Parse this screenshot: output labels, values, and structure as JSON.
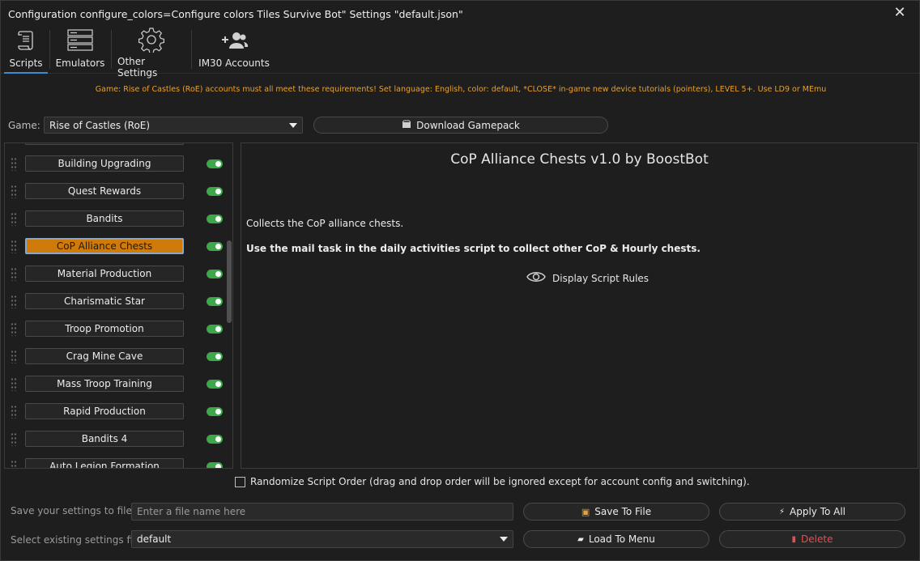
{
  "window": {
    "title": "Configuration configure_colors=Configure colors Tiles Survive Bot\" Settings \"default.json\"",
    "close_label": "✕"
  },
  "toolbar": {
    "tabs": [
      {
        "label": "Scripts",
        "icon": "scroll-icon",
        "active": true
      },
      {
        "label": "Emulators",
        "icon": "server-icon",
        "active": false
      },
      {
        "label": "Other Settings",
        "icon": "gear-icon",
        "active": false
      },
      {
        "label": "IM30 Accounts",
        "icon": "add-users-icon",
        "active": false
      }
    ]
  },
  "notice": "Game: Rise of Castles (RoE) accounts must all meet these requirements! Set language: English, color: default, *CLOSE* in-game new device tutorials (pointers), LEVEL 5+. Use LD9 or MEmu",
  "game": {
    "label": "Game:",
    "selected": "Rise of Castles (RoE)",
    "download_label": "Download Gamepack"
  },
  "scripts": [
    {
      "label": "Building Upgrading",
      "enabled": true,
      "selected": false
    },
    {
      "label": "Quest Rewards",
      "enabled": true,
      "selected": false
    },
    {
      "label": "Bandits",
      "enabled": true,
      "selected": false
    },
    {
      "label": "CoP Alliance Chests",
      "enabled": true,
      "selected": true
    },
    {
      "label": "Material Production",
      "enabled": true,
      "selected": false
    },
    {
      "label": "Charismatic Star",
      "enabled": true,
      "selected": false
    },
    {
      "label": "Troop Promotion",
      "enabled": true,
      "selected": false
    },
    {
      "label": "Crag Mine Cave",
      "enabled": true,
      "selected": false
    },
    {
      "label": "Mass Troop Training",
      "enabled": true,
      "selected": false
    },
    {
      "label": "Rapid Production",
      "enabled": true,
      "selected": false
    },
    {
      "label": "Bandits 4",
      "enabled": true,
      "selected": false
    },
    {
      "label": "Auto Legion Formation",
      "enabled": true,
      "selected": false
    }
  ],
  "detail": {
    "title": "CoP Alliance Chests v1.0 by BoostBot",
    "description": "Collects the CoP alliance chests.",
    "note": "Use the mail task in the daily activities script to collect other CoP & Hourly chests.",
    "rules_link": "Display Script Rules"
  },
  "randomize": {
    "checked": false,
    "label": "Randomize Script Order (drag and drop order will be ignored except for account config and switching)."
  },
  "save": {
    "label": "Save your settings to file",
    "placeholder": "Enter a file name here",
    "save_button": "Save To File",
    "apply_button": "Apply To All"
  },
  "load": {
    "label": "Select existing settings file",
    "selected": "default",
    "load_button": "Load To Menu",
    "delete_button": "Delete"
  },
  "colors": {
    "accent": "#3b8bd4",
    "selected_script": "#d07a0a",
    "toggle_on": "#3ca84a",
    "notice": "#e8a030",
    "delete": "#e05050"
  }
}
